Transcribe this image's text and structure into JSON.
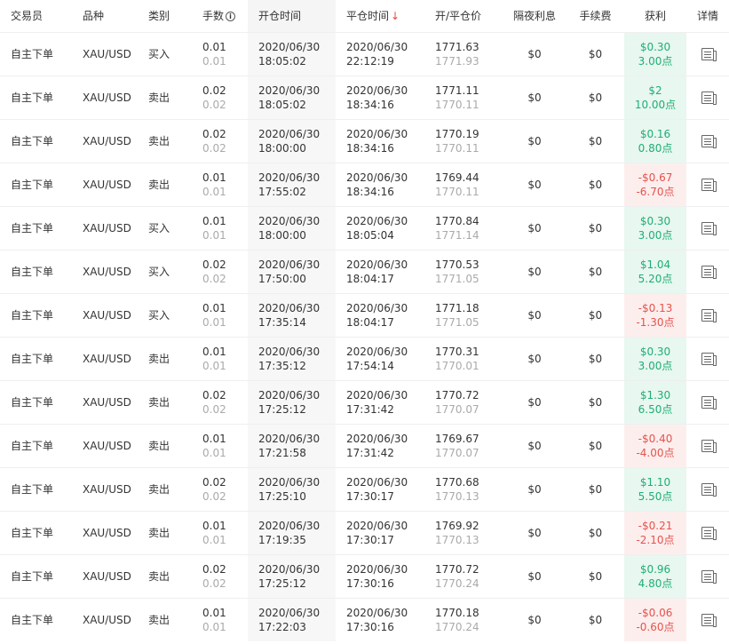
{
  "header": {
    "trader": "交易员",
    "symbol": "品种",
    "type": "类别",
    "lots": "手数",
    "open_time": "开仓时间",
    "close_time": "平仓时间",
    "price": "开/平仓价",
    "swap": "隔夜利息",
    "fee": "手续费",
    "profit": "获利",
    "details": "详情"
  },
  "icons": {
    "lots_info": "info-icon",
    "sort": "arrow-down-icon",
    "details": "document-icon"
  },
  "colors": {
    "gain": "#1fae75",
    "loss": "#e5534b",
    "sort": "#e5483f"
  },
  "rows": [
    {
      "trader": "自主下单",
      "symbol": "XAU/USD",
      "type": "买入",
      "lots": "0.01",
      "lots_sub": "0.01",
      "open_date": "2020/06/30",
      "open_time": "18:05:02",
      "close_date": "2020/06/30",
      "close_time": "22:12:19",
      "open_price": "1771.63",
      "close_price": "1771.93",
      "swap": "$0",
      "fee": "$0",
      "profit": "$0.30",
      "points": "3.00点",
      "status": "gain"
    },
    {
      "trader": "自主下单",
      "symbol": "XAU/USD",
      "type": "卖出",
      "lots": "0.02",
      "lots_sub": "0.02",
      "open_date": "2020/06/30",
      "open_time": "18:05:02",
      "close_date": "2020/06/30",
      "close_time": "18:34:16",
      "open_price": "1771.11",
      "close_price": "1770.11",
      "swap": "$0",
      "fee": "$0",
      "profit": "$2",
      "points": "10.00点",
      "status": "gain"
    },
    {
      "trader": "自主下单",
      "symbol": "XAU/USD",
      "type": "卖出",
      "lots": "0.02",
      "lots_sub": "0.02",
      "open_date": "2020/06/30",
      "open_time": "18:00:00",
      "close_date": "2020/06/30",
      "close_time": "18:34:16",
      "open_price": "1770.19",
      "close_price": "1770.11",
      "swap": "$0",
      "fee": "$0",
      "profit": "$0.16",
      "points": "0.80点",
      "status": "gain"
    },
    {
      "trader": "自主下单",
      "symbol": "XAU/USD",
      "type": "卖出",
      "lots": "0.01",
      "lots_sub": "0.01",
      "open_date": "2020/06/30",
      "open_time": "17:55:02",
      "close_date": "2020/06/30",
      "close_time": "18:34:16",
      "open_price": "1769.44",
      "close_price": "1770.11",
      "swap": "$0",
      "fee": "$0",
      "profit": "-$0.67",
      "points": "-6.70点",
      "status": "loss"
    },
    {
      "trader": "自主下单",
      "symbol": "XAU/USD",
      "type": "买入",
      "lots": "0.01",
      "lots_sub": "0.01",
      "open_date": "2020/06/30",
      "open_time": "18:00:00",
      "close_date": "2020/06/30",
      "close_time": "18:05:04",
      "open_price": "1770.84",
      "close_price": "1771.14",
      "swap": "$0",
      "fee": "$0",
      "profit": "$0.30",
      "points": "3.00点",
      "status": "gain"
    },
    {
      "trader": "自主下单",
      "symbol": "XAU/USD",
      "type": "买入",
      "lots": "0.02",
      "lots_sub": "0.02",
      "open_date": "2020/06/30",
      "open_time": "17:50:00",
      "close_date": "2020/06/30",
      "close_time": "18:04:17",
      "open_price": "1770.53",
      "close_price": "1771.05",
      "swap": "$0",
      "fee": "$0",
      "profit": "$1.04",
      "points": "5.20点",
      "status": "gain"
    },
    {
      "trader": "自主下单",
      "symbol": "XAU/USD",
      "type": "买入",
      "lots": "0.01",
      "lots_sub": "0.01",
      "open_date": "2020/06/30",
      "open_time": "17:35:14",
      "close_date": "2020/06/30",
      "close_time": "18:04:17",
      "open_price": "1771.18",
      "close_price": "1771.05",
      "swap": "$0",
      "fee": "$0",
      "profit": "-$0.13",
      "points": "-1.30点",
      "status": "loss"
    },
    {
      "trader": "自主下单",
      "symbol": "XAU/USD",
      "type": "卖出",
      "lots": "0.01",
      "lots_sub": "0.01",
      "open_date": "2020/06/30",
      "open_time": "17:35:12",
      "close_date": "2020/06/30",
      "close_time": "17:54:14",
      "open_price": "1770.31",
      "close_price": "1770.01",
      "swap": "$0",
      "fee": "$0",
      "profit": "$0.30",
      "points": "3.00点",
      "status": "gain"
    },
    {
      "trader": "自主下单",
      "symbol": "XAU/USD",
      "type": "卖出",
      "lots": "0.02",
      "lots_sub": "0.02",
      "open_date": "2020/06/30",
      "open_time": "17:25:12",
      "close_date": "2020/06/30",
      "close_time": "17:31:42",
      "open_price": "1770.72",
      "close_price": "1770.07",
      "swap": "$0",
      "fee": "$0",
      "profit": "$1.30",
      "points": "6.50点",
      "status": "gain"
    },
    {
      "trader": "自主下单",
      "symbol": "XAU/USD",
      "type": "卖出",
      "lots": "0.01",
      "lots_sub": "0.01",
      "open_date": "2020/06/30",
      "open_time": "17:21:58",
      "close_date": "2020/06/30",
      "close_time": "17:31:42",
      "open_price": "1769.67",
      "close_price": "1770.07",
      "swap": "$0",
      "fee": "$0",
      "profit": "-$0.40",
      "points": "-4.00点",
      "status": "loss"
    },
    {
      "trader": "自主下单",
      "symbol": "XAU/USD",
      "type": "卖出",
      "lots": "0.02",
      "lots_sub": "0.02",
      "open_date": "2020/06/30",
      "open_time": "17:25:10",
      "close_date": "2020/06/30",
      "close_time": "17:30:17",
      "open_price": "1770.68",
      "close_price": "1770.13",
      "swap": "$0",
      "fee": "$0",
      "profit": "$1.10",
      "points": "5.50点",
      "status": "gain"
    },
    {
      "trader": "自主下单",
      "symbol": "XAU/USD",
      "type": "卖出",
      "lots": "0.01",
      "lots_sub": "0.01",
      "open_date": "2020/06/30",
      "open_time": "17:19:35",
      "close_date": "2020/06/30",
      "close_time": "17:30:17",
      "open_price": "1769.92",
      "close_price": "1770.13",
      "swap": "$0",
      "fee": "$0",
      "profit": "-$0.21",
      "points": "-2.10点",
      "status": "loss"
    },
    {
      "trader": "自主下单",
      "symbol": "XAU/USD",
      "type": "卖出",
      "lots": "0.02",
      "lots_sub": "0.02",
      "open_date": "2020/06/30",
      "open_time": "17:25:12",
      "close_date": "2020/06/30",
      "close_time": "17:30:16",
      "open_price": "1770.72",
      "close_price": "1770.24",
      "swap": "$0",
      "fee": "$0",
      "profit": "$0.96",
      "points": "4.80点",
      "status": "gain"
    },
    {
      "trader": "自主下单",
      "symbol": "XAU/USD",
      "type": "卖出",
      "lots": "0.01",
      "lots_sub": "0.01",
      "open_date": "2020/06/30",
      "open_time": "17:22:03",
      "close_date": "2020/06/30",
      "close_time": "17:30:16",
      "open_price": "1770.18",
      "close_price": "1770.24",
      "swap": "$0",
      "fee": "$0",
      "profit": "-$0.06",
      "points": "-0.60点",
      "status": "loss"
    }
  ]
}
